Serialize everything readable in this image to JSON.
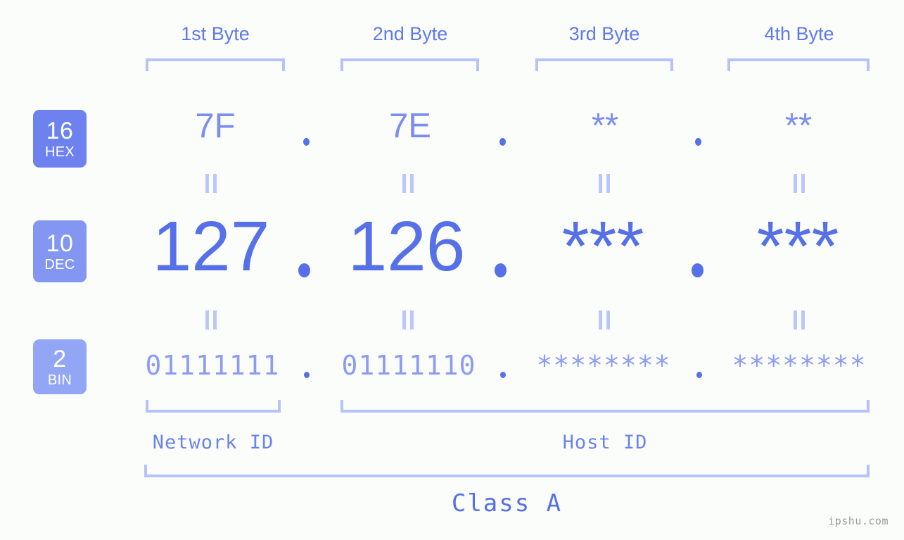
{
  "watermark": "ipshu.com",
  "byte_headers": [
    {
      "label": "1st Byte"
    },
    {
      "label": "2nd Byte"
    },
    {
      "label": "3rd Byte"
    },
    {
      "label": "4th Byte"
    }
  ],
  "bases": [
    {
      "num": "16",
      "sys": "HEX",
      "color": "#6d82ef"
    },
    {
      "num": "10",
      "sys": "DEC",
      "color": "#8396f2"
    },
    {
      "num": "2",
      "sys": "BIN",
      "color": "#93a5f5"
    }
  ],
  "rows": {
    "hex": {
      "base_num": "16",
      "base_sys": "HEX",
      "values": [
        "7F",
        "7E",
        "**",
        "**"
      ],
      "separator": "."
    },
    "dec": {
      "base_num": "10",
      "base_sys": "DEC",
      "values": [
        "127",
        "126",
        "***",
        "***"
      ],
      "separator": "."
    },
    "bin": {
      "base_num": "2",
      "base_sys": "BIN",
      "values": [
        "01111111",
        "01111110",
        "********",
        "********"
      ],
      "separator": "."
    }
  },
  "sections": {
    "network_id": "Network ID",
    "host_id": "Host ID",
    "class": "Class A"
  },
  "colors": {
    "background": "#fbfdfa",
    "bracket": "#b6c2fb",
    "hex_text": "#7b8ef0",
    "dec_text": "#5570e8",
    "bin_text": "#8c9cf3",
    "header_text": "#5f78ee",
    "equals_mark": "#bcc6fb",
    "watermark_text": "#9a9a9a"
  }
}
